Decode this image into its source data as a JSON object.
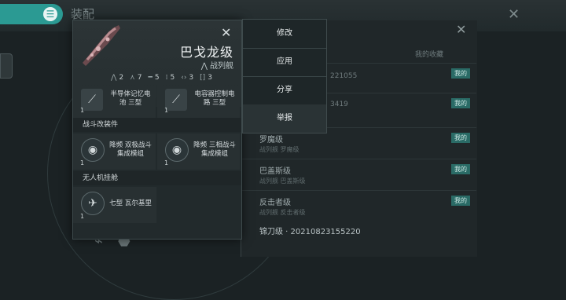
{
  "header": {
    "title": "装配"
  },
  "list": {
    "col_label": "我的收藏",
    "mine_badge": "我的",
    "codes": [
      "221055",
      "3419"
    ],
    "rows": [
      {
        "name": "罗魔级",
        "sub": "战列舰 罗魔级"
      },
      {
        "name": "巴盖斯级",
        "sub": "战列舰 巴盖斯级"
      },
      {
        "name": "反击者级",
        "sub": "战列舰 反击者级"
      }
    ],
    "bottom_item": "锦刀级 · 20210823155220"
  },
  "ship": {
    "name": "巴戈龙级",
    "class": "战列舰",
    "stats": [
      {
        "icon": "high-slot-icon",
        "value": "2"
      },
      {
        "icon": "mid-slot-icon",
        "value": "7"
      },
      {
        "icon": "low-slot-icon",
        "value": "5"
      },
      {
        "icon": "rig-slot-icon",
        "value": "5"
      },
      {
        "icon": "drone-icon",
        "value": "3"
      },
      {
        "icon": "module-bracket-icon",
        "value": "3"
      }
    ],
    "modules": [
      {
        "label": "半导体记忆电池 三型",
        "count": "1"
      },
      {
        "label": "电容器控制电路 三型",
        "count": "1"
      }
    ],
    "combat_rigs_title": "战斗改装件",
    "combat_rigs": [
      {
        "label": "降频 双极战斗集成模组",
        "count": "1"
      },
      {
        "label": "降频 三相战斗集成模组",
        "count": "1"
      }
    ],
    "drone_bay_title": "无人机挂舱",
    "drones": [
      {
        "label": "七型 瓦尔基里",
        "count": "1"
      }
    ]
  },
  "menu": {
    "edit": "修改",
    "apply": "应用",
    "share": "分享",
    "report": "举报"
  }
}
